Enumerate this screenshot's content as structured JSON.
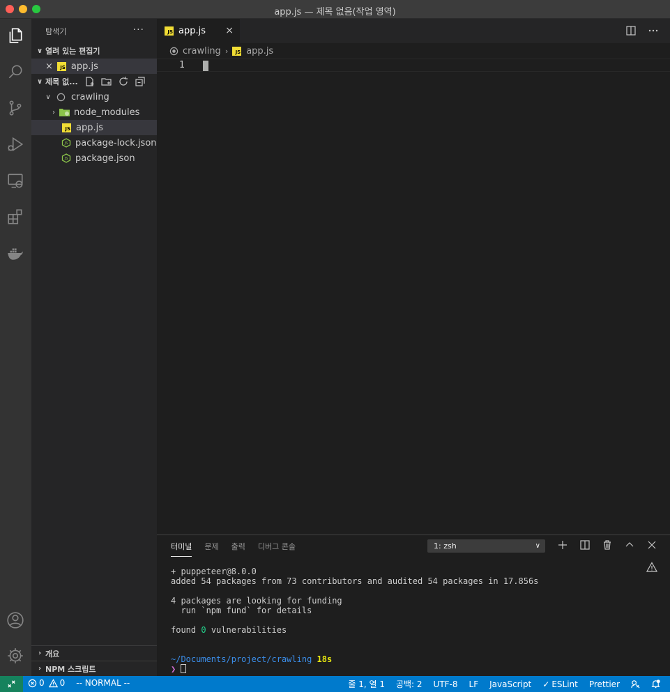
{
  "window": {
    "title": "app.js — 제목 없음(작업 영역)"
  },
  "activity_bar": {
    "items": [
      "files-icon",
      "search-icon",
      "source-control-icon",
      "run-debug-icon",
      "remote-explorer-icon",
      "extensions-icon",
      "docker-icon",
      "account-icon",
      "settings-gear-icon"
    ]
  },
  "sidebar": {
    "header": "탐색기",
    "more": "···",
    "open_editors": {
      "title": "열려 있는 편집기",
      "files": [
        {
          "name": "app.js"
        }
      ]
    },
    "workspace": {
      "title": "제목 없...",
      "root": "crawling",
      "items": [
        {
          "name": "node_modules",
          "type": "folder"
        },
        {
          "name": "app.js",
          "type": "js"
        },
        {
          "name": "package-lock.json",
          "type": "node"
        },
        {
          "name": "package.json",
          "type": "node"
        }
      ]
    },
    "outline": "개요",
    "npm_scripts": "NPM 스크립트"
  },
  "editor": {
    "tab": {
      "label": "app.js",
      "close": "×"
    },
    "breadcrumb": {
      "root": "crawling",
      "file": "app.js"
    },
    "line_number": "1"
  },
  "panel": {
    "tabs": [
      "터미널",
      "문제",
      "출력",
      "디버그 콘솔"
    ],
    "active_tab": "터미널",
    "terminal_select": "1: zsh",
    "output": {
      "line1": "+ puppeteer@8.0.0",
      "line2": "added 54 packages from 73 contributors and audited 54 packages in 17.856s",
      "line3": "4 packages are looking for funding",
      "line4": "  run `npm fund` for details",
      "found_pre": "found ",
      "found_count": "0",
      "found_post": " vulnerabilities",
      "path": "~/Documents/project/crawling",
      "duration": "18s",
      "prompt": "❯"
    }
  },
  "status_bar": {
    "errors": "0",
    "warnings": "0",
    "mode": "-- NORMAL --",
    "position": "줄 1, 열 1",
    "spaces": "공백: 2",
    "encoding": "UTF-8",
    "eol": "LF",
    "language": "JavaScript",
    "eslint": "ESLint",
    "prettier": "Prettier"
  },
  "colors": {
    "accent": "#007acc",
    "remote": "#16825d",
    "js_badge": "#f1dd35"
  }
}
